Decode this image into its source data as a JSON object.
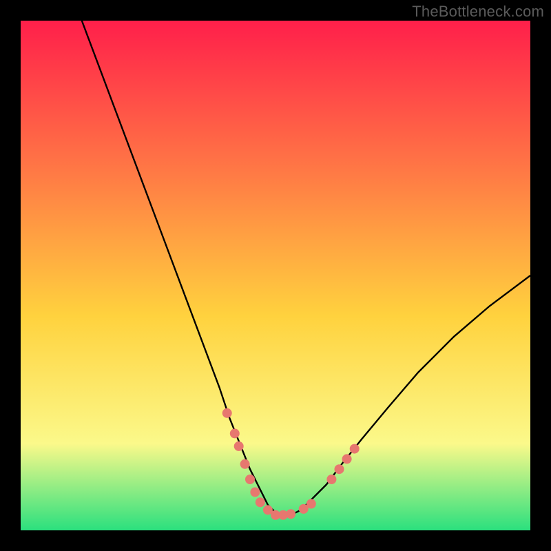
{
  "watermark": "TheBottleneck.com",
  "colors": {
    "black": "#000000",
    "curve": "#000000",
    "marker": "#e7776f",
    "gradient_top": "#ff1f4a",
    "gradient_mid1": "#ff7a45",
    "gradient_mid2": "#ffd23e",
    "gradient_mid3": "#fbf98a",
    "gradient_bottom": "#2be07e"
  },
  "chart_data": {
    "type": "line",
    "title": "",
    "xlabel": "",
    "ylabel": "",
    "xlim": [
      0,
      100
    ],
    "ylim": [
      0,
      100
    ],
    "grid": false,
    "legend": false,
    "annotations": [],
    "series": [
      {
        "name": "curve",
        "x": [
          12,
          15,
          18,
          21,
          24,
          27,
          30,
          33,
          36,
          39,
          41,
          43,
          45,
          47,
          48.5,
          50,
          51.5,
          53,
          55,
          57,
          60,
          63,
          67,
          72,
          78,
          85,
          92,
          100
        ],
        "y": [
          100,
          92,
          84,
          76,
          68,
          60,
          52,
          44,
          36,
          28,
          22,
          17,
          12,
          8,
          5,
          3.5,
          3,
          3,
          4,
          6,
          9,
          13,
          18,
          24,
          31,
          38,
          44,
          50
        ]
      }
    ],
    "markers": {
      "name": "scatter-points",
      "x": [
        40.5,
        42,
        42.8,
        44,
        45,
        46,
        47,
        48.5,
        50,
        51.5,
        53,
        55.5,
        57,
        61,
        62.5,
        64,
        65.5
      ],
      "y": [
        23,
        19,
        16.5,
        13,
        10,
        7.5,
        5.5,
        4,
        3,
        3,
        3.2,
        4.2,
        5.2,
        10,
        12,
        14,
        16
      ]
    }
  }
}
